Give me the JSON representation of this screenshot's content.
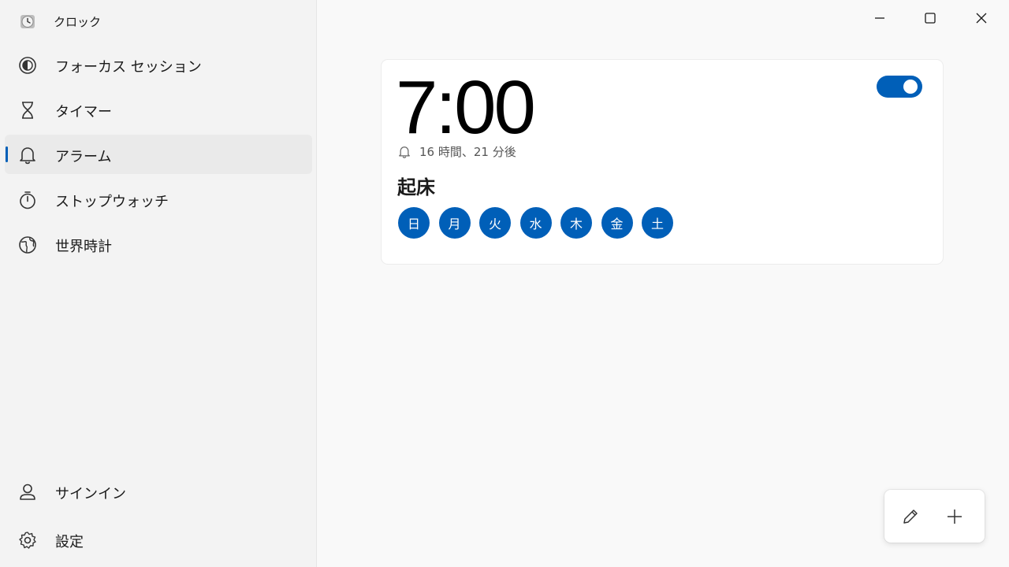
{
  "app": {
    "title": "クロック",
    "icon": "clock-app-icon"
  },
  "sidebar": {
    "items": [
      {
        "label": "フォーカス セッション",
        "icon": "focus-icon",
        "selected": false
      },
      {
        "label": "タイマー",
        "icon": "hourglass-icon",
        "selected": false
      },
      {
        "label": "アラーム",
        "icon": "bell-icon",
        "selected": true
      },
      {
        "label": "ストップウォッチ",
        "icon": "stopwatch-icon",
        "selected": false
      },
      {
        "label": "世界時計",
        "icon": "globe-icon",
        "selected": false
      }
    ],
    "bottom": [
      {
        "label": "サインイン",
        "icon": "person-icon"
      },
      {
        "label": "設定",
        "icon": "gear-icon"
      }
    ]
  },
  "window_controls": [
    "minimize",
    "maximize",
    "close"
  ],
  "alarm": {
    "time": "7:00",
    "enabled": true,
    "remaining": "16 時間、21 分後",
    "name": "起床",
    "days": [
      "日",
      "月",
      "火",
      "水",
      "木",
      "金",
      "土"
    ]
  },
  "actions": {
    "edit_icon": "pencil-icon",
    "add_icon": "plus-icon"
  },
  "colors": {
    "accent": "#005fb8",
    "sidebar_bg": "#f3f3f3",
    "content_bg": "#f9f9f9",
    "card_bg": "#ffffff"
  }
}
